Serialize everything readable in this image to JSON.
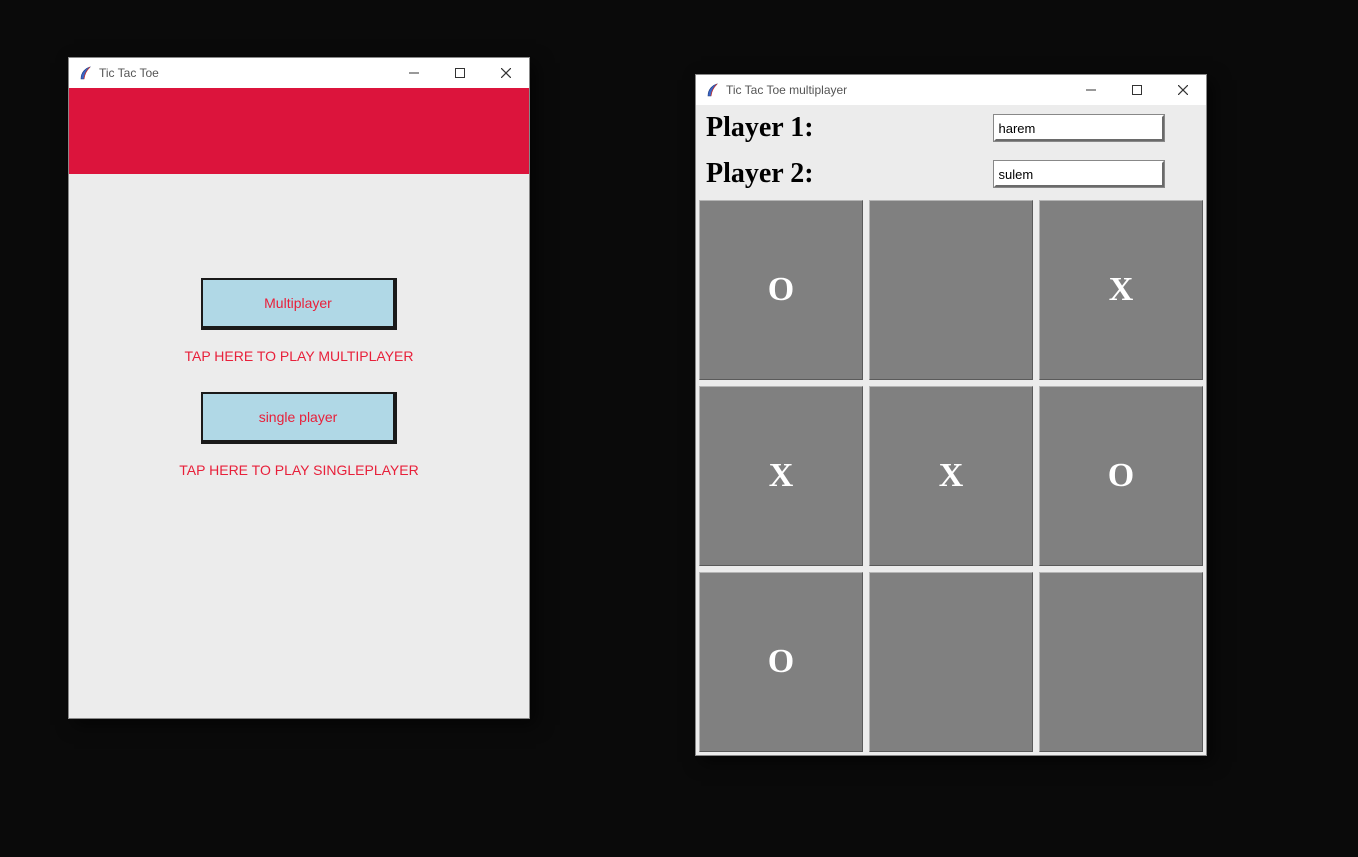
{
  "window1": {
    "title": "Tic Tac Toe",
    "buttons": {
      "multiplayer": "Multiplayer",
      "singleplayer": "single player"
    },
    "captions": {
      "multiplayer": "TAP HERE TO PLAY MULTIPLAYER",
      "singleplayer": "TAP HERE TO PLAY SINGLEPLAYER"
    }
  },
  "window2": {
    "title": "Tic Tac Toe multiplayer",
    "labels": {
      "player1": "Player 1:",
      "player2": "Player 2:"
    },
    "inputs": {
      "player1": "harem",
      "player2": "sulem"
    },
    "board": [
      [
        "O",
        "",
        "X"
      ],
      [
        "X",
        "X",
        "O"
      ],
      [
        "O",
        "",
        ""
      ]
    ]
  },
  "colors": {
    "accent_red": "#dc143c",
    "button_bg": "#b0d8e6",
    "cell_bg": "#808080"
  }
}
